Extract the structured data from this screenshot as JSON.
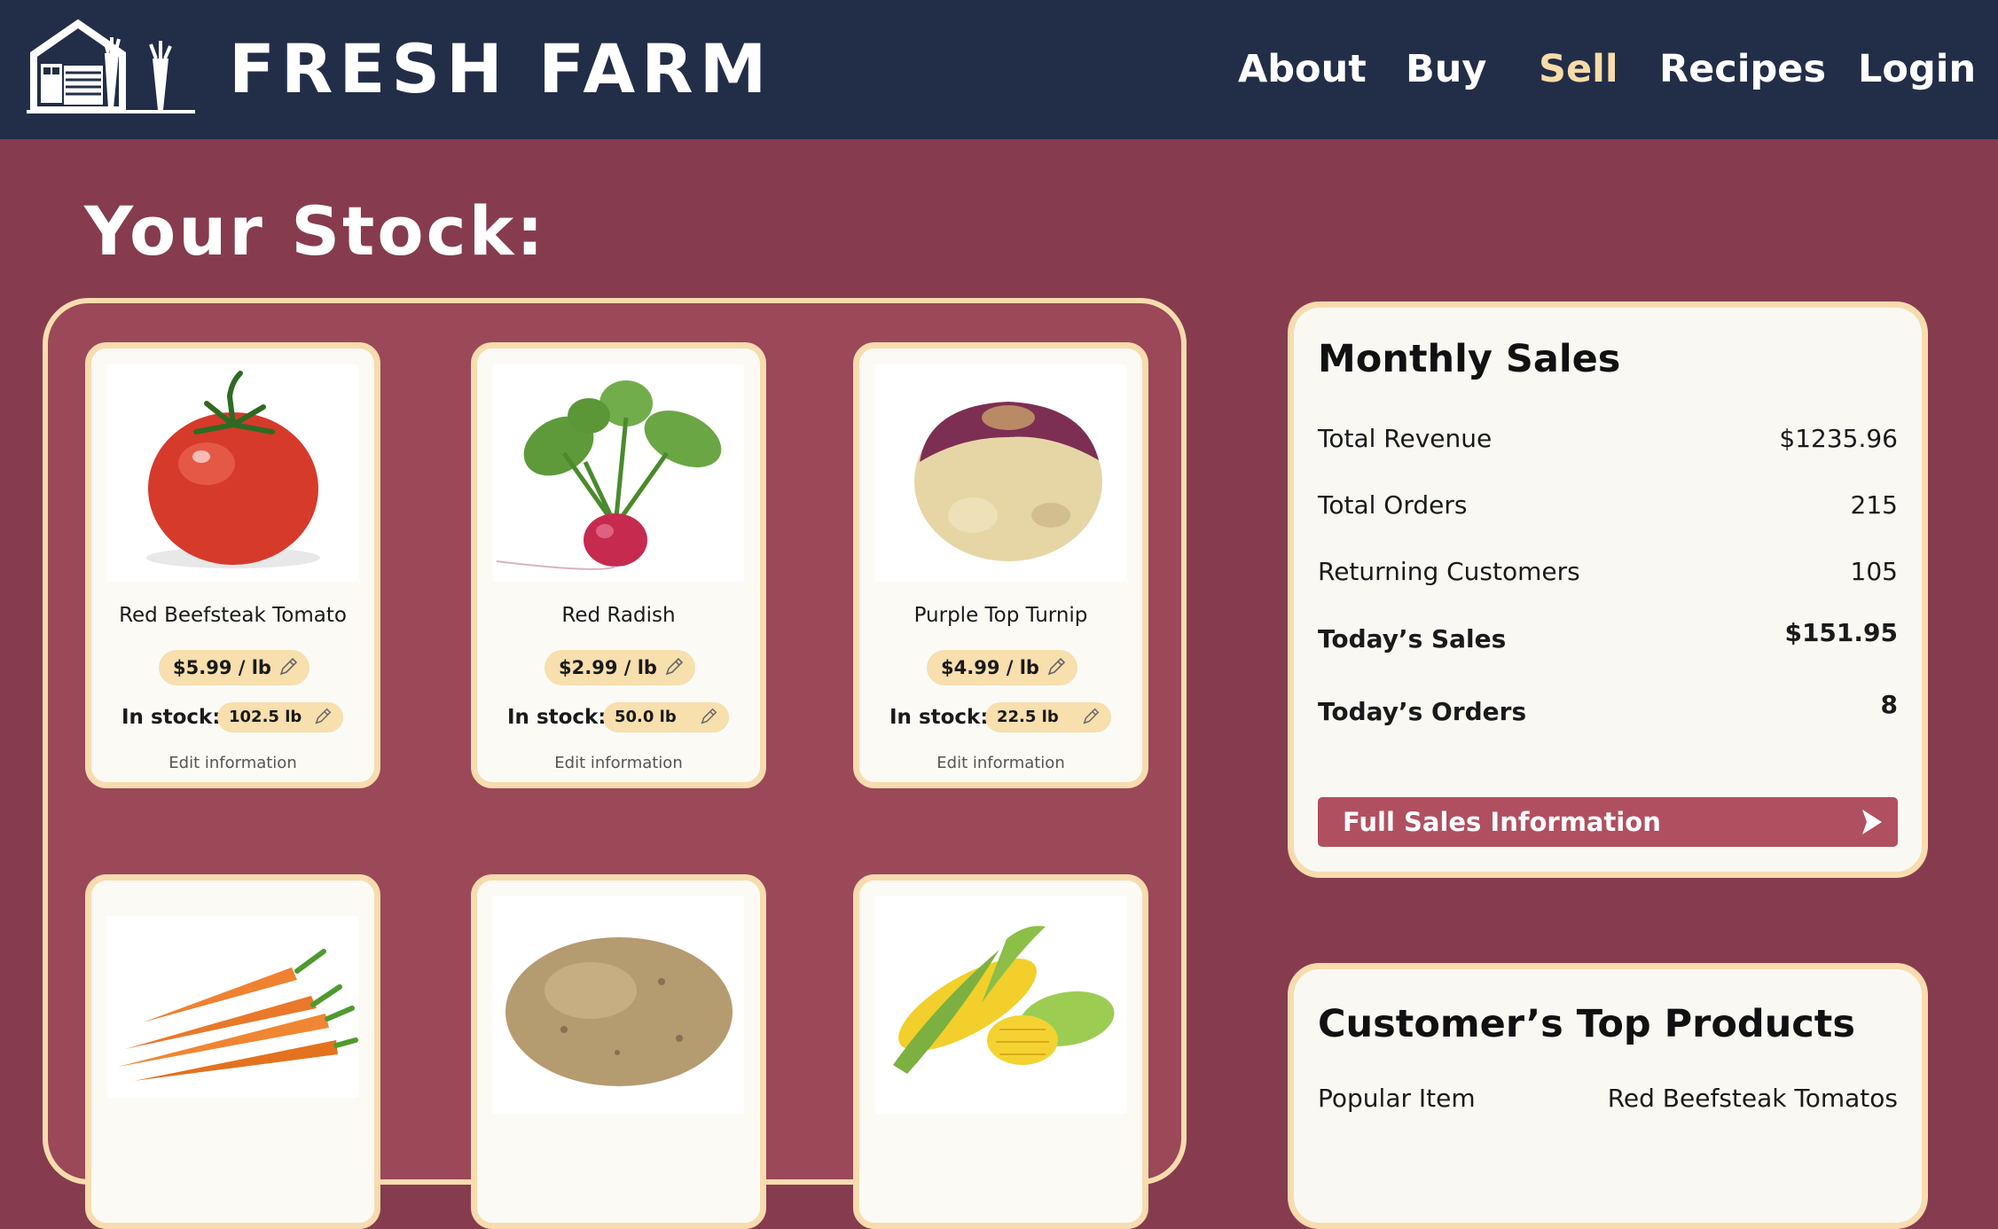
{
  "header": {
    "brand": "FRESH FARM",
    "nav": [
      "About",
      "Buy",
      "Sell",
      "Recipes",
      "Login"
    ],
    "active_nav": "Sell",
    "colors": {
      "bar": "#222d48",
      "active": "#f6dca8"
    }
  },
  "page": {
    "title": "Your Stock:"
  },
  "stock": {
    "products": [
      {
        "name": "Red Beefsteak Tomato",
        "price": "$5.99 / lb",
        "stock_label": "In stock:",
        "stock": "102.5 lb",
        "edit": "Edit information",
        "image": "tomato"
      },
      {
        "name": "Red Radish",
        "price": "$2.99 / lb",
        "stock_label": "In stock:",
        "stock": "50.0 lb",
        "edit": "Edit information",
        "image": "radish"
      },
      {
        "name": "Purple Top Turnip",
        "price": "$4.99 / lb",
        "stock_label": "In stock:",
        "stock": "22.5 lb",
        "edit": "Edit information",
        "image": "turnip"
      },
      {
        "image": "carrots"
      },
      {
        "image": "potato"
      },
      {
        "image": "corn"
      }
    ]
  },
  "monthly_sales": {
    "title": "Monthly Sales",
    "rows": [
      {
        "label": "Total Revenue",
        "value": "$1235.96"
      },
      {
        "label": "Total Orders",
        "value": "215"
      },
      {
        "label": "Returning Customers",
        "value": "105"
      },
      {
        "label": "Today’s Sales",
        "value": "$151.95"
      },
      {
        "label": "Today’s Orders",
        "value": "8"
      }
    ],
    "button": "Full Sales Information"
  },
  "top_products": {
    "title": "Customer’s Top Products",
    "rows": [
      {
        "label": "Popular Item",
        "value": "Red Beefsteak Tomatos"
      }
    ]
  },
  "theme": {
    "page_bg": "#863c4e",
    "panel_bg": "#9b4858",
    "border": "#f8dcae",
    "accent": "#b04f60"
  }
}
